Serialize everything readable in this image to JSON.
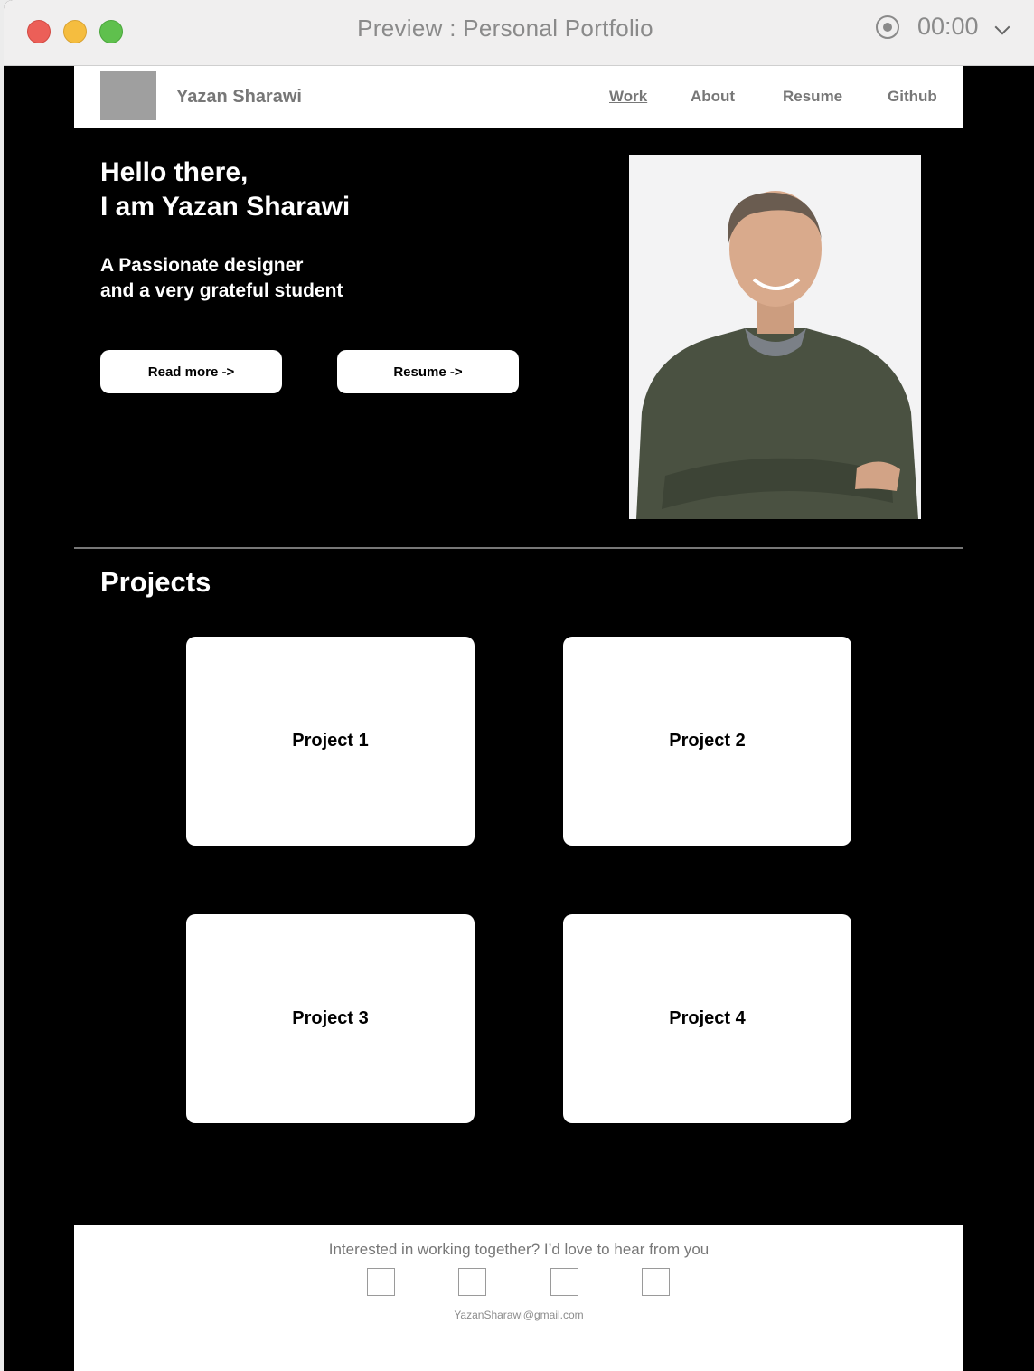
{
  "window": {
    "title": "Preview : Personal Portfolio",
    "timer": "00:00",
    "icons": [
      "close-dot",
      "minimize-dot",
      "zoom-dot",
      "record-icon",
      "chevron-down-icon"
    ]
  },
  "nav": {
    "brand": "Yazan Sharawi",
    "links": [
      "Work",
      "About",
      "Resume",
      "Github"
    ],
    "active": "Work"
  },
  "hero": {
    "greeting": "Hello there,\nI am Yazan Sharawi",
    "tagline": "A Passionate designer\nand a very grateful student",
    "buttons": [
      "Read more ->",
      "Resume ->"
    ]
  },
  "projects": {
    "title": "Projects",
    "items": [
      "Project 1",
      "Project 2",
      "Project 3",
      "Project 4"
    ]
  },
  "footer": {
    "text": "Interested in working together? I’d love to hear from you",
    "email": "YazanSharawi@gmail.com"
  },
  "colors": {
    "page_background": "#000000",
    "nav_text": "#777777",
    "card_background": "#ffffff"
  }
}
